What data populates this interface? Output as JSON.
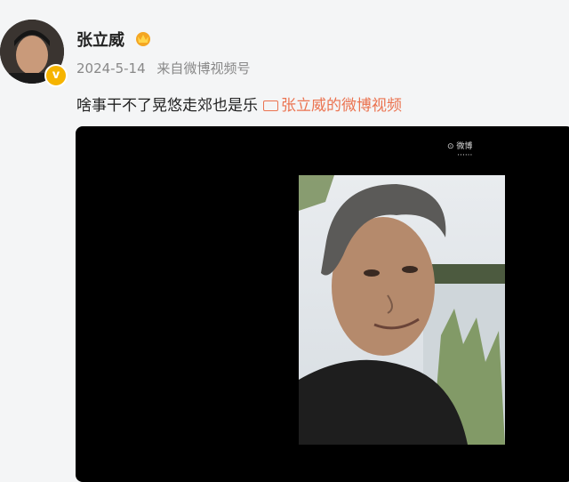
{
  "post": {
    "author": "张立威",
    "date": "2024-5-14",
    "source_prefix": "来自",
    "source": "微博视频号",
    "text": "啥事干不了晃悠走郊也是乐",
    "video_link_label": "张立威的微博视频",
    "verified_mark": "v"
  },
  "video": {
    "watermark_top": "⊙ 微博",
    "watermark_bottom": "······"
  },
  "icons": {
    "crown": "crown-icon",
    "video": "video-camera-icon",
    "verified": "verified-badge-icon"
  },
  "colors": {
    "link": "#eb7350",
    "badge": "#f6b400",
    "meta": "#888888"
  }
}
